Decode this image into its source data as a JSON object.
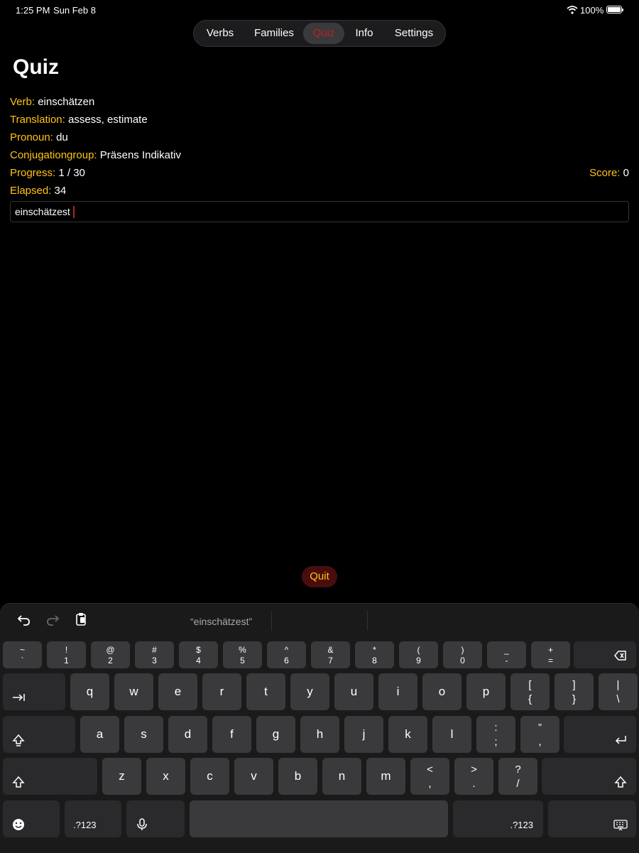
{
  "status": {
    "time": "1:25 PM",
    "date": "Sun Feb 8",
    "battery": "100%"
  },
  "tabs": [
    {
      "label": "Verbs",
      "active": false
    },
    {
      "label": "Families",
      "active": false
    },
    {
      "label": "Quiz",
      "active": true
    },
    {
      "label": "Info",
      "active": false
    },
    {
      "label": "Settings",
      "active": false
    }
  ],
  "page": {
    "title": "Quiz"
  },
  "quiz": {
    "verb_label": "Verb:",
    "verb": "einschätzen",
    "translation_label": "Translation:",
    "translation": "assess, estimate",
    "pronoun_label": "Pronoun:",
    "pronoun": "du",
    "group_label": "Conjugationgroup:",
    "group": "Präsens Indikativ",
    "progress_label": "Progress:",
    "progress": "1 / 30",
    "score_label": "Score:",
    "score": "0",
    "elapsed_label": "Elapsed:",
    "elapsed": "34",
    "answer": "einschätzest"
  },
  "quit_label": "Quit",
  "keyboard": {
    "suggestion": "“einschätzest”",
    "row1": [
      {
        "t": "~",
        "b": "`"
      },
      {
        "t": "!",
        "b": "1"
      },
      {
        "t": "@",
        "b": "2"
      },
      {
        "t": "#",
        "b": "3"
      },
      {
        "t": "$",
        "b": "4"
      },
      {
        "t": "%",
        "b": "5"
      },
      {
        "t": "^",
        "b": "6"
      },
      {
        "t": "&",
        "b": "7"
      },
      {
        "t": "*",
        "b": "8"
      },
      {
        "t": "(",
        "b": "9"
      },
      {
        "t": ")",
        "b": "0"
      },
      {
        "t": "_",
        "b": "-"
      },
      {
        "t": "+",
        "b": "="
      }
    ],
    "row2": [
      "q",
      "w",
      "e",
      "r",
      "t",
      "y",
      "u",
      "i",
      "o",
      "p"
    ],
    "row2_extra": [
      {
        "t": "[",
        "b": "{"
      },
      {
        "t": "]",
        "b": "}"
      },
      {
        "t": "|",
        "b": "\\"
      }
    ],
    "row3": [
      "a",
      "s",
      "d",
      "f",
      "g",
      "h",
      "j",
      "k",
      "l"
    ],
    "row3_extra": [
      {
        "t": ":",
        "b": ";"
      },
      {
        "t": "”",
        "b": ","
      }
    ],
    "row4": [
      "z",
      "x",
      "c",
      "v",
      "b",
      "n",
      "m"
    ],
    "row4_extra": [
      {
        "t": "<",
        "b": ","
      },
      {
        "t": ">",
        "b": "."
      },
      {
        "t": "?",
        "b": "/"
      }
    ],
    "numbers_label": ".?123",
    "icons": {
      "undo": "undo-icon",
      "redo": "redo-icon",
      "paste": "paste-icon",
      "delete": "delete-icon",
      "tab": "tab-icon",
      "shift": "shift-icon",
      "return": "return-icon",
      "emoji": "emoji-icon",
      "mic": "microphone-icon",
      "hide": "keyboard-hide-icon"
    }
  },
  "colors": {
    "label": "#ffc414",
    "accent": "#b3261e",
    "quit_bg": "#4a0d0d"
  }
}
